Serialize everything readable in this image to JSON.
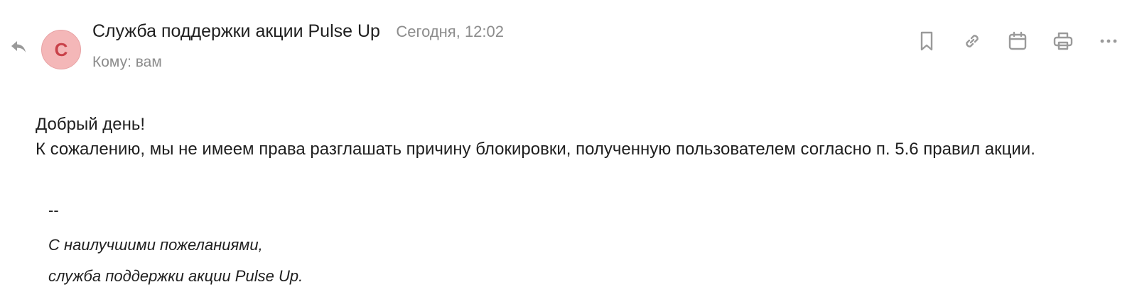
{
  "header": {
    "avatar_letter": "С",
    "sender": "Служба поддержки акции Pulse Up",
    "date": "Сегодня, 12:02",
    "to": "Кому: вам"
  },
  "toolbar": {
    "icons": [
      "bookmark-icon",
      "link-icon",
      "calendar-icon",
      "print-icon",
      "more-icon"
    ]
  },
  "message": {
    "greeting": "Добрый день!",
    "text": "К сожалению, мы не имеем права разглашать причину блокировки, полученную пользователем согласно п. 5.6 правил акции."
  },
  "signature": {
    "separator": "--",
    "line1": "С наилучшими пожеланиями,",
    "line2": "служба поддержки акции Pulse Up."
  },
  "colors": {
    "avatar_bg": "#f4b7b8",
    "avatar_text": "#c9424a",
    "muted_text": "#8c8c8c",
    "icon": "#9a9a9a"
  }
}
